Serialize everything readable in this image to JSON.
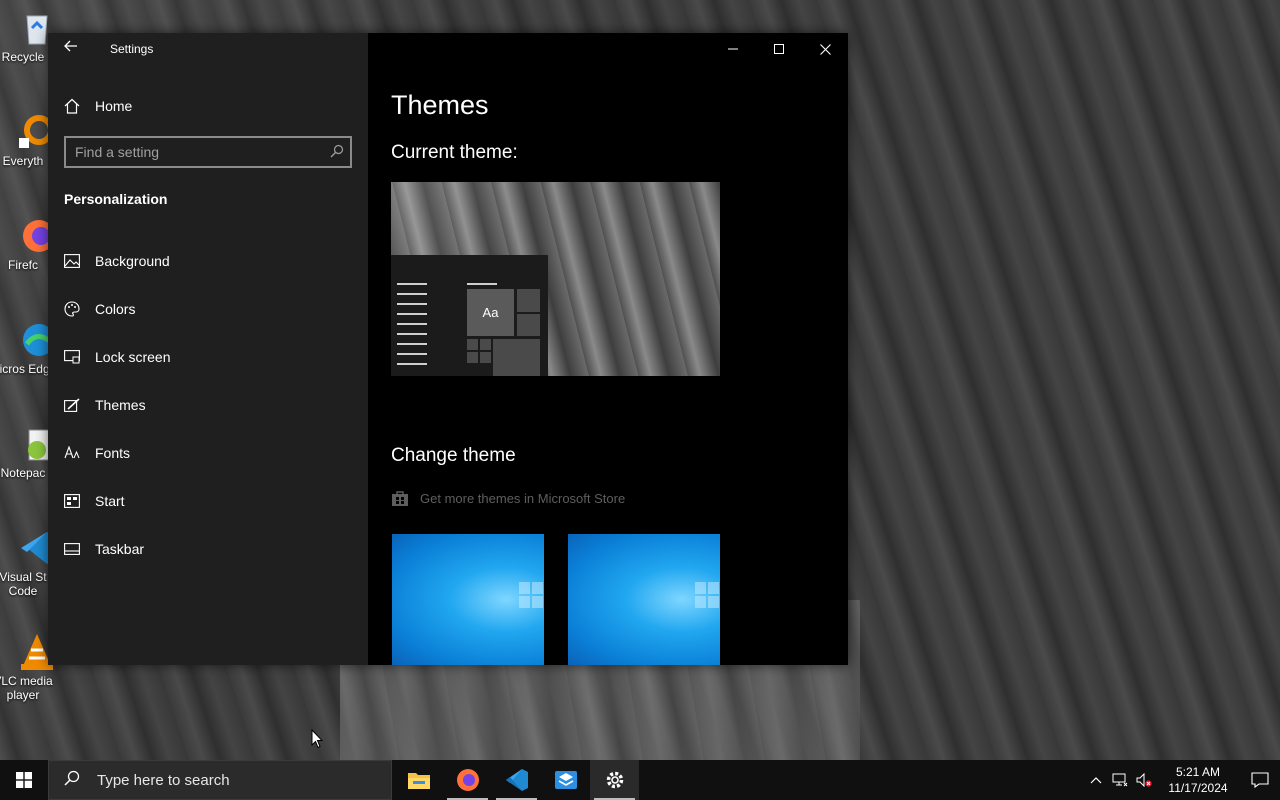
{
  "desktop": {
    "icons": [
      {
        "label": "Recycle",
        "icon": "recycle-bin-icon"
      },
      {
        "label": "Everyth",
        "icon": "everything-search-icon"
      },
      {
        "label": "Firefc",
        "icon": "firefox-icon"
      },
      {
        "label": "Micros Edge",
        "icon": "edge-icon"
      },
      {
        "label": "Notepac",
        "icon": "notepad-plus-icon"
      },
      {
        "label": "Visual St Code",
        "icon": "vscode-icon"
      },
      {
        "label": "VLC media player",
        "icon": "vlc-icon"
      }
    ]
  },
  "window": {
    "title": "Settings",
    "home_label": "Home",
    "search_placeholder": "Find a setting",
    "section": "Personalization",
    "nav": [
      {
        "label": "Background",
        "icon": "picture-icon"
      },
      {
        "label": "Colors",
        "icon": "palette-icon"
      },
      {
        "label": "Lock screen",
        "icon": "lock-screen-icon"
      },
      {
        "label": "Themes",
        "icon": "themes-icon"
      },
      {
        "label": "Fonts",
        "icon": "fonts-icon"
      },
      {
        "label": "Start",
        "icon": "start-icon"
      },
      {
        "label": "Taskbar",
        "icon": "taskbar-icon"
      }
    ],
    "main": {
      "page_title": "Themes",
      "current_theme_label": "Current theme:",
      "preview_tile_text": "Aa",
      "change_theme_label": "Change theme",
      "store_link": "Get more themes in Microsoft Store"
    }
  },
  "taskbar": {
    "search_placeholder": "Type here to search",
    "apps": [
      "file-explorer-icon",
      "firefox-icon",
      "vscode-icon",
      "app-installer-icon",
      "settings-gear-icon"
    ],
    "time": "5:21 AM",
    "date": "11/17/2024"
  },
  "colors": {
    "sidebar_bg": "#1f1f1f",
    "main_bg": "#000000",
    "taskbar_bg": "#101010",
    "theme_blue": "#0a7fd6"
  }
}
